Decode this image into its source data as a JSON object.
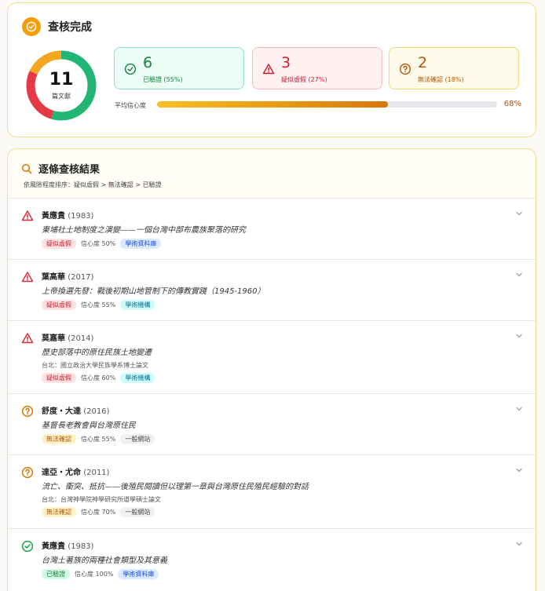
{
  "summary": {
    "title": "查核完成",
    "total": "11",
    "total_unit": "篇文獻",
    "breakdown": {
      "verified": 6,
      "suspect": 3,
      "unknown": 2
    },
    "verified": {
      "count": "6",
      "label": "已驗證 (55%)"
    },
    "suspect": {
      "count": "3",
      "label": "疑似虛假 (27%)"
    },
    "unknown": {
      "count": "2",
      "label": "無法確認 (18%)"
    },
    "confidence_label": "平均信心度",
    "confidence_value": "68%",
    "confidence_fraction": 0.68
  },
  "results": {
    "title": "逐條查核結果",
    "subtitle": "依風險程度排序：疑似虛假 > 無法確認 > 已驗證",
    "items": [
      {
        "author": "黃應貴",
        "year": "(1983)",
        "title": "東埔社土地制度之演變——一個台灣中部布農族聚落的研究",
        "source": "",
        "status": "疑似虛假",
        "confidence": "信心度 50%",
        "type": "學術資料庫"
      },
      {
        "author": "葉高華",
        "year": "(2017)",
        "title": "上帝換選先發：戰後初期山地管制下的傳教實踐（1945-1960）",
        "source": "",
        "status": "疑似虛假",
        "confidence": "信心度 55%",
        "type": "學術機構"
      },
      {
        "author": "莫嘉華",
        "year": "(2014)",
        "title": "歷史部落中的原住民族土地變遷",
        "source": "台北：國立政治大學民族學系博士論文",
        "status": "疑似虛假",
        "confidence": "信心度 60%",
        "type": "學術機構"
      },
      {
        "author": "舒度・大達",
        "year": "(2016)",
        "title": "基督長老教會與台灣原住民",
        "source": "",
        "status": "無法確認",
        "confidence": "信心度 55%",
        "type": "一般網站"
      },
      {
        "author": "達亞・尤命",
        "year": "(2011)",
        "title": "流亡、衝突、抵抗——後殖民閱讀但以理第一章與台灣原住民殖民經驗的對話",
        "source": "台北：台灣神學院神學研究所道學碩士論文",
        "status": "無法確認",
        "confidence": "信心度 70%",
        "type": "一般網站"
      },
      {
        "author": "黃應貴",
        "year": "(1983)",
        "title": "台灣土著族的兩種社會類型及其意義",
        "source": "",
        "status": "已驗證",
        "confidence": "信心度 100%",
        "type": "學術資料庫"
      }
    ]
  },
  "colors": {
    "verified": "#22b573",
    "suspect": "#e53945",
    "unknown": "#f5a51f",
    "accent": "#f59e0b"
  }
}
